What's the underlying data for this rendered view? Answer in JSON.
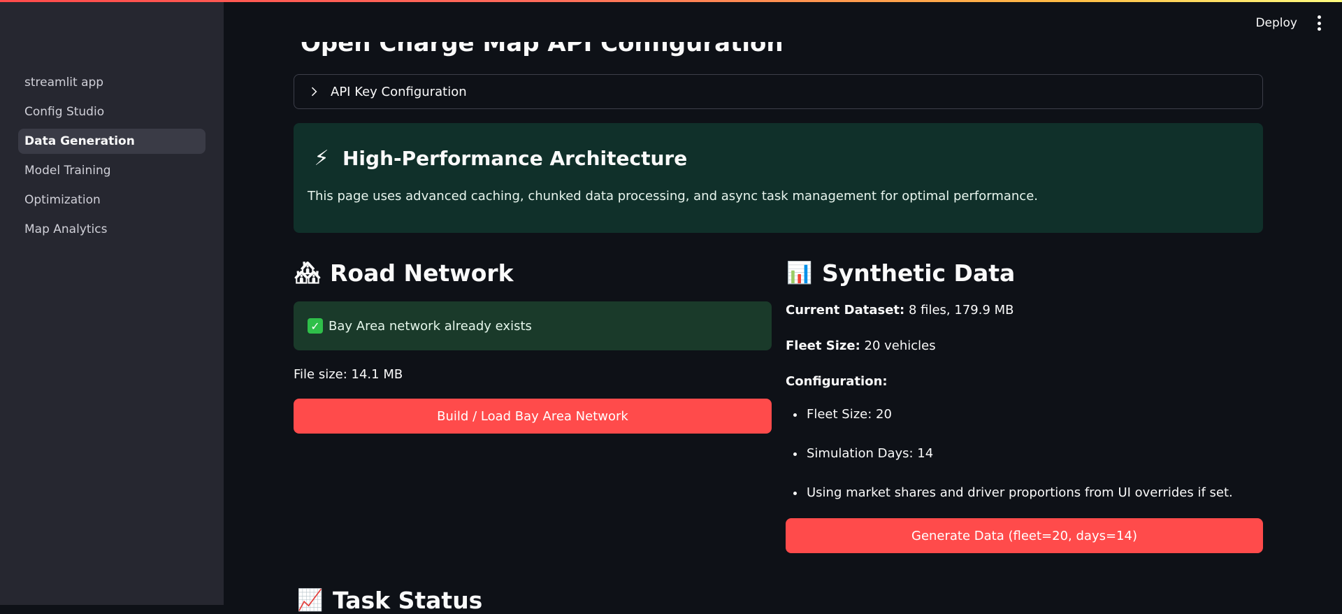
{
  "sidebar": {
    "items": [
      {
        "label": "streamlit app"
      },
      {
        "label": "Config Studio"
      },
      {
        "label": "Data Generation"
      },
      {
        "label": "Model Training"
      },
      {
        "label": "Optimization"
      },
      {
        "label": "Map Analytics"
      }
    ],
    "active_index": 2
  },
  "header": {
    "deploy_label": "Deploy"
  },
  "main": {
    "partial_title": "Open Charge Map API Configuration",
    "expander_label": "API Key Configuration",
    "info": {
      "title_icon": "⚡",
      "title": "High-Performance Architecture",
      "text": "This page uses advanced caching, chunked data processing, and async task management for optimal performance."
    },
    "road_network": {
      "icon": "🏘",
      "title": "Road Network",
      "success_text": "Bay Area network already exists",
      "file_size": "File size: 14.1 MB",
      "button_label": "Build / Load Bay Area Network"
    },
    "synthetic": {
      "icon": "📊",
      "title": "Synthetic Data",
      "current_dataset_label": "Current Dataset:",
      "current_dataset_value": " 8 files, 179.9 MB",
      "fleet_label": "Fleet Size:",
      "fleet_value": " 20 vehicles",
      "config_label": "Configuration:",
      "config_items": [
        "Fleet Size: 20",
        "Simulation Days: 14",
        "Using market shares and driver proportions from UI overrides if set."
      ],
      "button_label": "Generate Data (fleet=20, days=14)"
    },
    "task_status": {
      "icon": "📈",
      "title": "Task Status"
    }
  },
  "colors": {
    "background": "#0e1117",
    "sidebar": "#262730",
    "primary": "#ff4b4b",
    "info_bg": "#10302a",
    "success_bg": "#1a3a2a"
  }
}
